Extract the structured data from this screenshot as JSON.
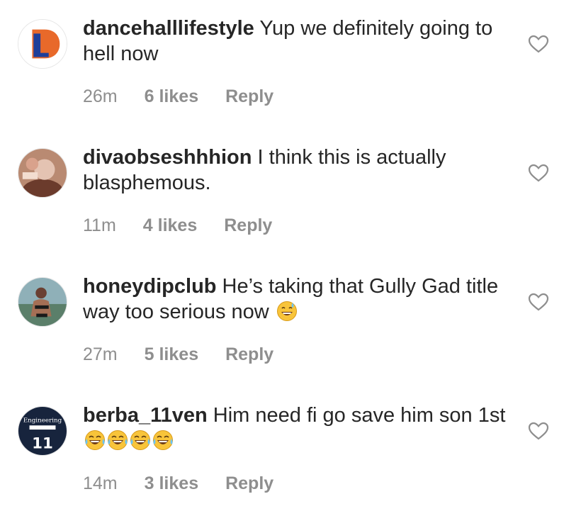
{
  "comments": [
    {
      "username": "dancehalllifestyle",
      "text": " Yup we definitely going to hell now",
      "time": "26m",
      "likes": "6 likes",
      "reply": "Reply",
      "avatar": "letter-d-logo-avatar",
      "emojis": 0
    },
    {
      "username": "divaobseshhhion",
      "text": " I think this is actually blasphemous.",
      "time": "11m",
      "likes": "4 likes",
      "reply": "Reply",
      "avatar": "photo-avatar",
      "emojis": 0
    },
    {
      "username": "honeydipclub",
      "text": " He’s taking that Gully Gad title way too serious now ",
      "time": "27m",
      "likes": "5 likes",
      "reply": "Reply",
      "avatar": "beach-photo-avatar",
      "emojis": 1,
      "emoji_name": "grinning-sweat-emoji"
    },
    {
      "username": "berba_11ven",
      "text": " Him need fi go save him son 1st ",
      "time": "14m",
      "likes": "3 likes",
      "reply": "Reply",
      "avatar": "jersey-11-avatar",
      "emojis": 4,
      "emoji_name": "tears-of-joy-emoji"
    }
  ],
  "avatar_lettering": {
    "jersey": [
      "Engineering",
      "11"
    ]
  },
  "colors": {
    "text": "#262626",
    "meta": "#8e8e8e",
    "logo_orange": "#e8692a",
    "logo_blue": "#1f3f9a"
  }
}
